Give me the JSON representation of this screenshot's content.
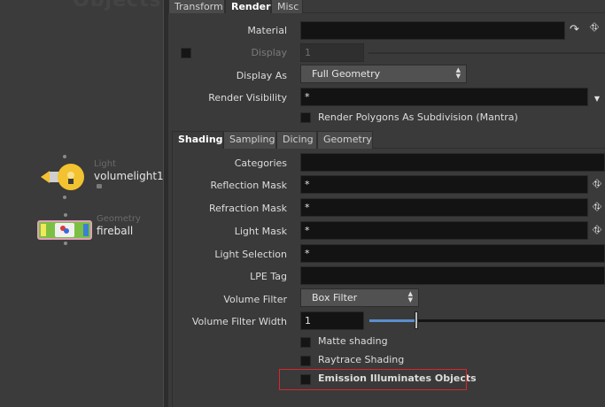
{
  "network": {
    "title": "Objects",
    "nodes": [
      {
        "type": "Light",
        "name": "volumelight1"
      },
      {
        "type": "Geometry",
        "name": "fireball"
      }
    ]
  },
  "tabs": [
    {
      "label": "Transform"
    },
    {
      "label": "Render",
      "active": true
    },
    {
      "label": "Misc"
    }
  ],
  "render": {
    "material_label": "Material",
    "material_value": "",
    "display_label": "Display",
    "display_value": "1",
    "display_as_label": "Display As",
    "display_as_value": "Full Geometry",
    "render_visibility_label": "Render Visibility",
    "render_visibility_value": "*",
    "render_polygons_label": "Render Polygons As Subdivision (Mantra)"
  },
  "subtabs": [
    {
      "label": "Shading",
      "active": true
    },
    {
      "label": "Sampling"
    },
    {
      "label": "Dicing"
    },
    {
      "label": "Geometry"
    }
  ],
  "shading": {
    "categories_label": "Categories",
    "categories_value": "",
    "reflection_mask_label": "Reflection Mask",
    "reflection_mask_value": "*",
    "refraction_mask_label": "Refraction Mask",
    "refraction_mask_value": "*",
    "light_mask_label": "Light Mask",
    "light_mask_value": "*",
    "light_selection_label": "Light Selection",
    "light_selection_value": "*",
    "lpe_tag_label": "LPE Tag",
    "lpe_tag_value": "",
    "volume_filter_label": "Volume Filter",
    "volume_filter_value": "Box Filter",
    "volume_filter_width_label": "Volume Filter Width",
    "volume_filter_width_value": "1",
    "volume_filter_width_slider": 0.2,
    "matte_shading_label": "Matte shading",
    "raytrace_shading_label": "Raytrace Shading",
    "emission_illuminates_label": "Emission Illuminates Objects"
  },
  "colors": {
    "highlight": "#d9262c",
    "slider_blue": "#5a8fd0",
    "light_bulb": "#f2c230",
    "geometry_body": "#7bc043"
  }
}
